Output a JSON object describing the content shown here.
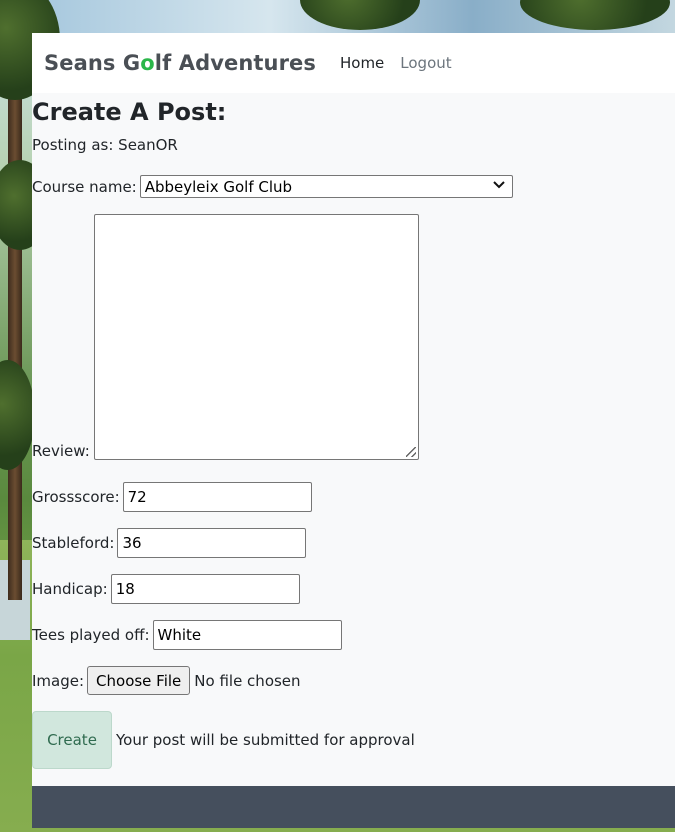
{
  "navbar": {
    "brand_prefix": "Seans G",
    "brand_o": "o",
    "brand_suffix": "lf Adventures",
    "links": [
      "Home",
      "Logout"
    ]
  },
  "form": {
    "title": "Create A Post:",
    "posting_as": "Posting as: SeanOR",
    "course_label": "Course name:",
    "course_value": "Abbeyleix Golf Club",
    "review_label": "Review:",
    "review_value": "",
    "grossscore_label": "Grossscore:",
    "grossscore_value": "72",
    "stableford_label": "Stableford:",
    "stableford_value": "36",
    "handicap_label": "Handicap:",
    "handicap_value": "18",
    "tees_label": "Tees played off:",
    "tees_value": "White",
    "image_label": "Image:",
    "file_button": "Choose File",
    "file_status": "No file chosen",
    "create_button": "Create",
    "submit_note": "Your post will be submitted for approval"
  },
  "colors": {
    "brand_accent": "#2bb64a",
    "create_button_bg": "#d1e7dd",
    "footer_bg": "#454f5d"
  }
}
